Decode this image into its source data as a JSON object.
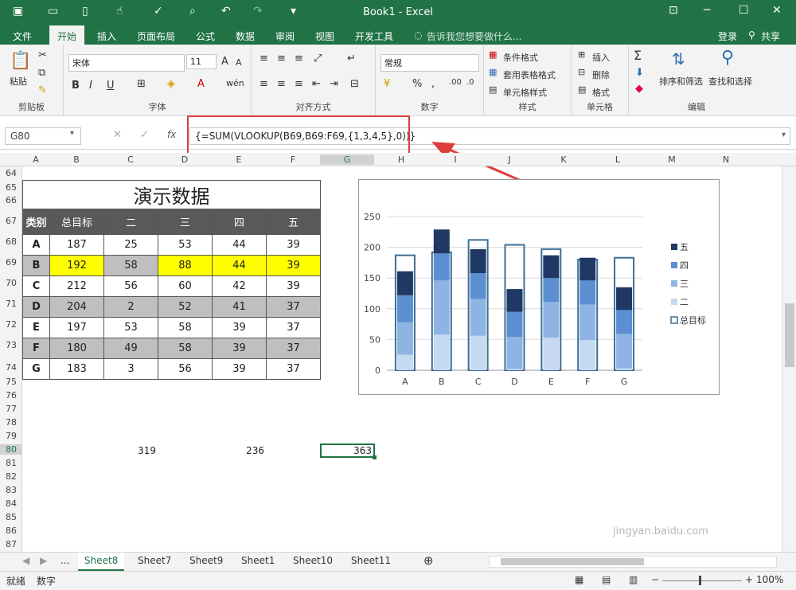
{
  "window": {
    "title": "Book1 - Excel"
  },
  "ribbon_tabs": [
    "文件",
    "开始",
    "插入",
    "页面布局",
    "公式",
    "数据",
    "审阅",
    "视图",
    "开发工具"
  ],
  "tell_me": "告诉我您想要做什么...",
  "signin": "登录",
  "share": "共享",
  "clipboard": {
    "paste": "粘贴",
    "label": "剪贴板"
  },
  "font": {
    "name": "宋体",
    "size": "11",
    "label": "字体",
    "bold": "B",
    "italic": "I",
    "underline": "U",
    "phonetic": "wén"
  },
  "alignment": {
    "label": "对齐方式"
  },
  "number": {
    "format": "常规",
    "label": "数字",
    "percent": "%",
    "comma": ","
  },
  "styles": {
    "conditional": "条件格式",
    "table": "套用表格格式",
    "cell": "单元格样式",
    "label": "样式"
  },
  "cells": {
    "insert": "插入",
    "delete": "删除",
    "format": "格式",
    "label": "单元格"
  },
  "editing": {
    "sort": "排序和筛选",
    "find": "查找和选择",
    "label": "编辑"
  },
  "formula_bar": {
    "name_box": "G80",
    "fx": "fx",
    "formula": "{=SUM(VLOOKUP(B69,B69:F69,{1,3,4,5},0))}"
  },
  "columns": [
    "A",
    "B",
    "C",
    "D",
    "E",
    "F",
    "G",
    "H",
    "I",
    "J",
    "K",
    "L",
    "M",
    "N"
  ],
  "rows": [
    "64",
    "65",
    "66",
    "67",
    "68",
    "69",
    "70",
    "71",
    "72",
    "73",
    "74",
    "75",
    "76",
    "77",
    "78",
    "79",
    "80",
    "81",
    "82",
    "83",
    "84",
    "85",
    "86",
    "87"
  ],
  "table": {
    "title": "演示数据",
    "headers": [
      "类别",
      "总目标",
      "二",
      "三",
      "四",
      "五"
    ],
    "rows": [
      [
        "A",
        "187",
        "25",
        "53",
        "44",
        "39"
      ],
      [
        "B",
        "192",
        "58",
        "88",
        "44",
        "39"
      ],
      [
        "C",
        "212",
        "56",
        "60",
        "42",
        "39"
      ],
      [
        "D",
        "204",
        "2",
        "52",
        "41",
        "37"
      ],
      [
        "E",
        "197",
        "53",
        "58",
        "39",
        "37"
      ],
      [
        "F",
        "180",
        "49",
        "58",
        "39",
        "37"
      ],
      [
        "G",
        "183",
        "3",
        "56",
        "39",
        "37"
      ]
    ]
  },
  "row80": {
    "c": "319",
    "e": "236",
    "g": "363"
  },
  "colors": {
    "excel_green": "#217346",
    "highlight_yellow": "#ffff00",
    "row_gray": "#bfbfbf",
    "header_dark": "#595959",
    "callout_red": "#e03b3b"
  },
  "chart_data": {
    "type": "bar",
    "categories": [
      "A",
      "B",
      "C",
      "D",
      "E",
      "F",
      "G"
    ],
    "series": [
      {
        "name": "二",
        "values": [
          25,
          58,
          56,
          2,
          53,
          49,
          3
        ],
        "color": "#c5d9f1"
      },
      {
        "name": "三",
        "values": [
          53,
          88,
          60,
          52,
          58,
          58,
          56
        ],
        "color": "#8eb4e3"
      },
      {
        "name": "四",
        "values": [
          44,
          44,
          42,
          41,
          39,
          39,
          39
        ],
        "color": "#5b8fd2"
      },
      {
        "name": "五",
        "values": [
          39,
          39,
          39,
          37,
          37,
          37,
          37
        ],
        "color": "#1f3864"
      },
      {
        "name": "总目标",
        "values": [
          187,
          192,
          212,
          204,
          197,
          180,
          183
        ],
        "color": "#3c6e94"
      }
    ],
    "stacked": true,
    "ylim": [
      0,
      250
    ],
    "yticks": [
      "0",
      "50",
      "100",
      "150",
      "200",
      "250"
    ],
    "legend_order": [
      "五",
      "四",
      "三",
      "二",
      "总目标"
    ],
    "legend": "right",
    "grid": true
  },
  "sheets": [
    "Sheet8",
    "Sheet7",
    "Sheet9",
    "Sheet1",
    "Sheet10",
    "Sheet11"
  ],
  "sheet_nav_more": "...",
  "status": {
    "ready": "就绪",
    "mode": "数字",
    "zoom": "100%"
  },
  "watermark": "jingyan.baidu.com"
}
